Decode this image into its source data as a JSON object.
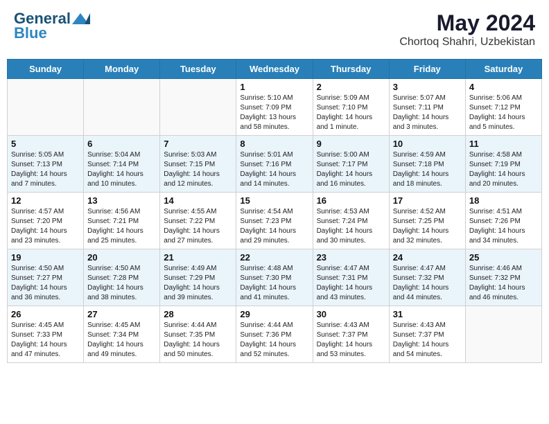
{
  "header": {
    "logo_line1": "General",
    "logo_line2": "Blue",
    "month": "May 2024",
    "location": "Chortoq Shahri, Uzbekistan"
  },
  "weekdays": [
    "Sunday",
    "Monday",
    "Tuesday",
    "Wednesday",
    "Thursday",
    "Friday",
    "Saturday"
  ],
  "weeks": [
    [
      {
        "day": "",
        "info": ""
      },
      {
        "day": "",
        "info": ""
      },
      {
        "day": "",
        "info": ""
      },
      {
        "day": "1",
        "info": "Sunrise: 5:10 AM\nSunset: 7:09 PM\nDaylight: 13 hours\nand 58 minutes."
      },
      {
        "day": "2",
        "info": "Sunrise: 5:09 AM\nSunset: 7:10 PM\nDaylight: 14 hours\nand 1 minute."
      },
      {
        "day": "3",
        "info": "Sunrise: 5:07 AM\nSunset: 7:11 PM\nDaylight: 14 hours\nand 3 minutes."
      },
      {
        "day": "4",
        "info": "Sunrise: 5:06 AM\nSunset: 7:12 PM\nDaylight: 14 hours\nand 5 minutes."
      }
    ],
    [
      {
        "day": "5",
        "info": "Sunrise: 5:05 AM\nSunset: 7:13 PM\nDaylight: 14 hours\nand 7 minutes."
      },
      {
        "day": "6",
        "info": "Sunrise: 5:04 AM\nSunset: 7:14 PM\nDaylight: 14 hours\nand 10 minutes."
      },
      {
        "day": "7",
        "info": "Sunrise: 5:03 AM\nSunset: 7:15 PM\nDaylight: 14 hours\nand 12 minutes."
      },
      {
        "day": "8",
        "info": "Sunrise: 5:01 AM\nSunset: 7:16 PM\nDaylight: 14 hours\nand 14 minutes."
      },
      {
        "day": "9",
        "info": "Sunrise: 5:00 AM\nSunset: 7:17 PM\nDaylight: 14 hours\nand 16 minutes."
      },
      {
        "day": "10",
        "info": "Sunrise: 4:59 AM\nSunset: 7:18 PM\nDaylight: 14 hours\nand 18 minutes."
      },
      {
        "day": "11",
        "info": "Sunrise: 4:58 AM\nSunset: 7:19 PM\nDaylight: 14 hours\nand 20 minutes."
      }
    ],
    [
      {
        "day": "12",
        "info": "Sunrise: 4:57 AM\nSunset: 7:20 PM\nDaylight: 14 hours\nand 23 minutes."
      },
      {
        "day": "13",
        "info": "Sunrise: 4:56 AM\nSunset: 7:21 PM\nDaylight: 14 hours\nand 25 minutes."
      },
      {
        "day": "14",
        "info": "Sunrise: 4:55 AM\nSunset: 7:22 PM\nDaylight: 14 hours\nand 27 minutes."
      },
      {
        "day": "15",
        "info": "Sunrise: 4:54 AM\nSunset: 7:23 PM\nDaylight: 14 hours\nand 29 minutes."
      },
      {
        "day": "16",
        "info": "Sunrise: 4:53 AM\nSunset: 7:24 PM\nDaylight: 14 hours\nand 30 minutes."
      },
      {
        "day": "17",
        "info": "Sunrise: 4:52 AM\nSunset: 7:25 PM\nDaylight: 14 hours\nand 32 minutes."
      },
      {
        "day": "18",
        "info": "Sunrise: 4:51 AM\nSunset: 7:26 PM\nDaylight: 14 hours\nand 34 minutes."
      }
    ],
    [
      {
        "day": "19",
        "info": "Sunrise: 4:50 AM\nSunset: 7:27 PM\nDaylight: 14 hours\nand 36 minutes."
      },
      {
        "day": "20",
        "info": "Sunrise: 4:50 AM\nSunset: 7:28 PM\nDaylight: 14 hours\nand 38 minutes."
      },
      {
        "day": "21",
        "info": "Sunrise: 4:49 AM\nSunset: 7:29 PM\nDaylight: 14 hours\nand 39 minutes."
      },
      {
        "day": "22",
        "info": "Sunrise: 4:48 AM\nSunset: 7:30 PM\nDaylight: 14 hours\nand 41 minutes."
      },
      {
        "day": "23",
        "info": "Sunrise: 4:47 AM\nSunset: 7:31 PM\nDaylight: 14 hours\nand 43 minutes."
      },
      {
        "day": "24",
        "info": "Sunrise: 4:47 AM\nSunset: 7:32 PM\nDaylight: 14 hours\nand 44 minutes."
      },
      {
        "day": "25",
        "info": "Sunrise: 4:46 AM\nSunset: 7:32 PM\nDaylight: 14 hours\nand 46 minutes."
      }
    ],
    [
      {
        "day": "26",
        "info": "Sunrise: 4:45 AM\nSunset: 7:33 PM\nDaylight: 14 hours\nand 47 minutes."
      },
      {
        "day": "27",
        "info": "Sunrise: 4:45 AM\nSunset: 7:34 PM\nDaylight: 14 hours\nand 49 minutes."
      },
      {
        "day": "28",
        "info": "Sunrise: 4:44 AM\nSunset: 7:35 PM\nDaylight: 14 hours\nand 50 minutes."
      },
      {
        "day": "29",
        "info": "Sunrise: 4:44 AM\nSunset: 7:36 PM\nDaylight: 14 hours\nand 52 minutes."
      },
      {
        "day": "30",
        "info": "Sunrise: 4:43 AM\nSunset: 7:37 PM\nDaylight: 14 hours\nand 53 minutes."
      },
      {
        "day": "31",
        "info": "Sunrise: 4:43 AM\nSunset: 7:37 PM\nDaylight: 14 hours\nand 54 minutes."
      },
      {
        "day": "",
        "info": ""
      }
    ]
  ]
}
